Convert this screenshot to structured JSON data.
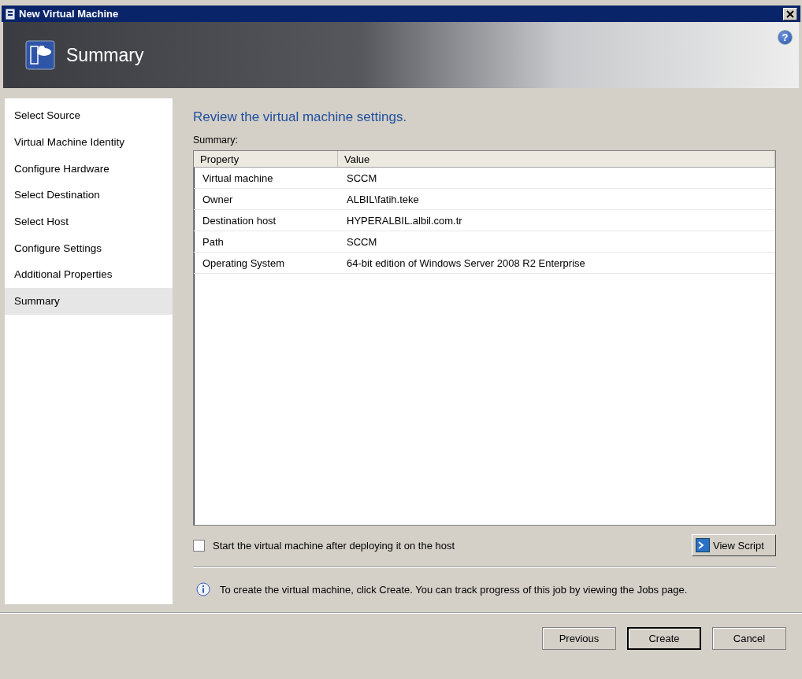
{
  "window": {
    "title": "New Virtual Machine"
  },
  "header": {
    "title": "Summary",
    "help": "?"
  },
  "sidebar": {
    "items": [
      {
        "label": "Select Source",
        "selected": false
      },
      {
        "label": "Virtual Machine Identity",
        "selected": false
      },
      {
        "label": "Configure Hardware",
        "selected": false
      },
      {
        "label": "Select Destination",
        "selected": false
      },
      {
        "label": "Select Host",
        "selected": false
      },
      {
        "label": "Configure Settings",
        "selected": false
      },
      {
        "label": "Additional Properties",
        "selected": false
      },
      {
        "label": "Summary",
        "selected": true
      }
    ]
  },
  "content": {
    "heading": "Review the virtual machine settings.",
    "table_label": "Summary:",
    "table": {
      "columns": [
        "Property",
        "Value"
      ],
      "rows": [
        [
          "Virtual machine",
          "SCCM"
        ],
        [
          "Owner",
          "ALBIL\\fatih.teke"
        ],
        [
          "Destination host",
          "HYPERALBIL.albil.com.tr"
        ],
        [
          "Path",
          "SCCM"
        ],
        [
          "Operating System",
          "64-bit edition of Windows Server 2008 R2 Enterprise"
        ]
      ]
    },
    "start_checkbox": {
      "label": "Start the virtual machine after deploying it on the host",
      "checked": false
    },
    "view_script_button": "View Script",
    "info": "To create the virtual machine, click Create.  You can track progress of this job by viewing the Jobs page."
  },
  "buttons": [
    {
      "label": "Previous",
      "default": false
    },
    {
      "label": "Create",
      "default": true
    },
    {
      "label": "Cancel",
      "default": false
    }
  ]
}
